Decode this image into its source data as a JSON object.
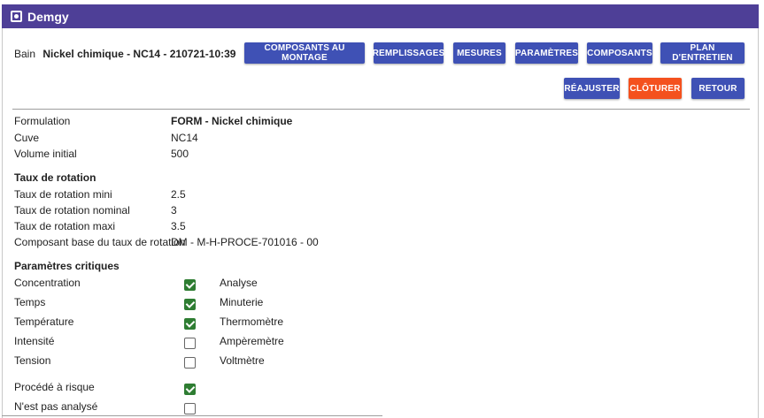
{
  "app": {
    "title": "Demgy"
  },
  "header": {
    "bain_label": "Bain",
    "bain_value": "Nickel chimique - NC14 - 210721-10:39"
  },
  "toolbar": {
    "composants_montage": "COMPOSANTS AU MONTAGE",
    "remplissages": "REMPLISSAGES",
    "mesures": "MESURES",
    "parametres": "PARAMÈTRES",
    "composants": "COMPOSANTS",
    "plan_entretien": "PLAN D'ENTRETIEN",
    "reajuster": "RÉAJUSTER",
    "cloturer": "CLÔTURER",
    "retour": "RETOUR"
  },
  "colors": {
    "appbar": "#4e3f97",
    "button": "#3f51b5",
    "button_alert": "#f4511e",
    "check": "#2e7d32"
  },
  "details": {
    "formulation_label": "Formulation",
    "formulation_value": "FORM - Nickel chimique",
    "cuve_label": "Cuve",
    "cuve_value": "NC14",
    "volume_label": "Volume initial",
    "volume_value": "500"
  },
  "rotation": {
    "title": "Taux de rotation",
    "mini_label": "Taux de rotation mini",
    "mini_value": "2.5",
    "nominal_label": "Taux de rotation nominal",
    "nominal_value": "3",
    "maxi_label": "Taux de rotation maxi",
    "maxi_value": "3.5",
    "base_label": "Composant base du taux de rotation",
    "base_value": "DM - M-H-PROCE-701016 - 00"
  },
  "critical": {
    "title": "Paramètres critiques",
    "items": [
      {
        "label": "Concentration",
        "checked": true,
        "tool": "Analyse"
      },
      {
        "label": "Temps",
        "checked": true,
        "tool": "Minuterie"
      },
      {
        "label": "Température",
        "checked": true,
        "tool": "Thermomètre"
      },
      {
        "label": "Intensité",
        "checked": false,
        "tool": "Ampèremètre"
      },
      {
        "label": "Tension",
        "checked": false,
        "tool": "Voltmètre"
      }
    ]
  },
  "flags": {
    "risque_label": "Procédé à risque",
    "risque_checked": true,
    "non_analyse_label": "N'est pas analysé",
    "non_analyse_checked": false
  }
}
